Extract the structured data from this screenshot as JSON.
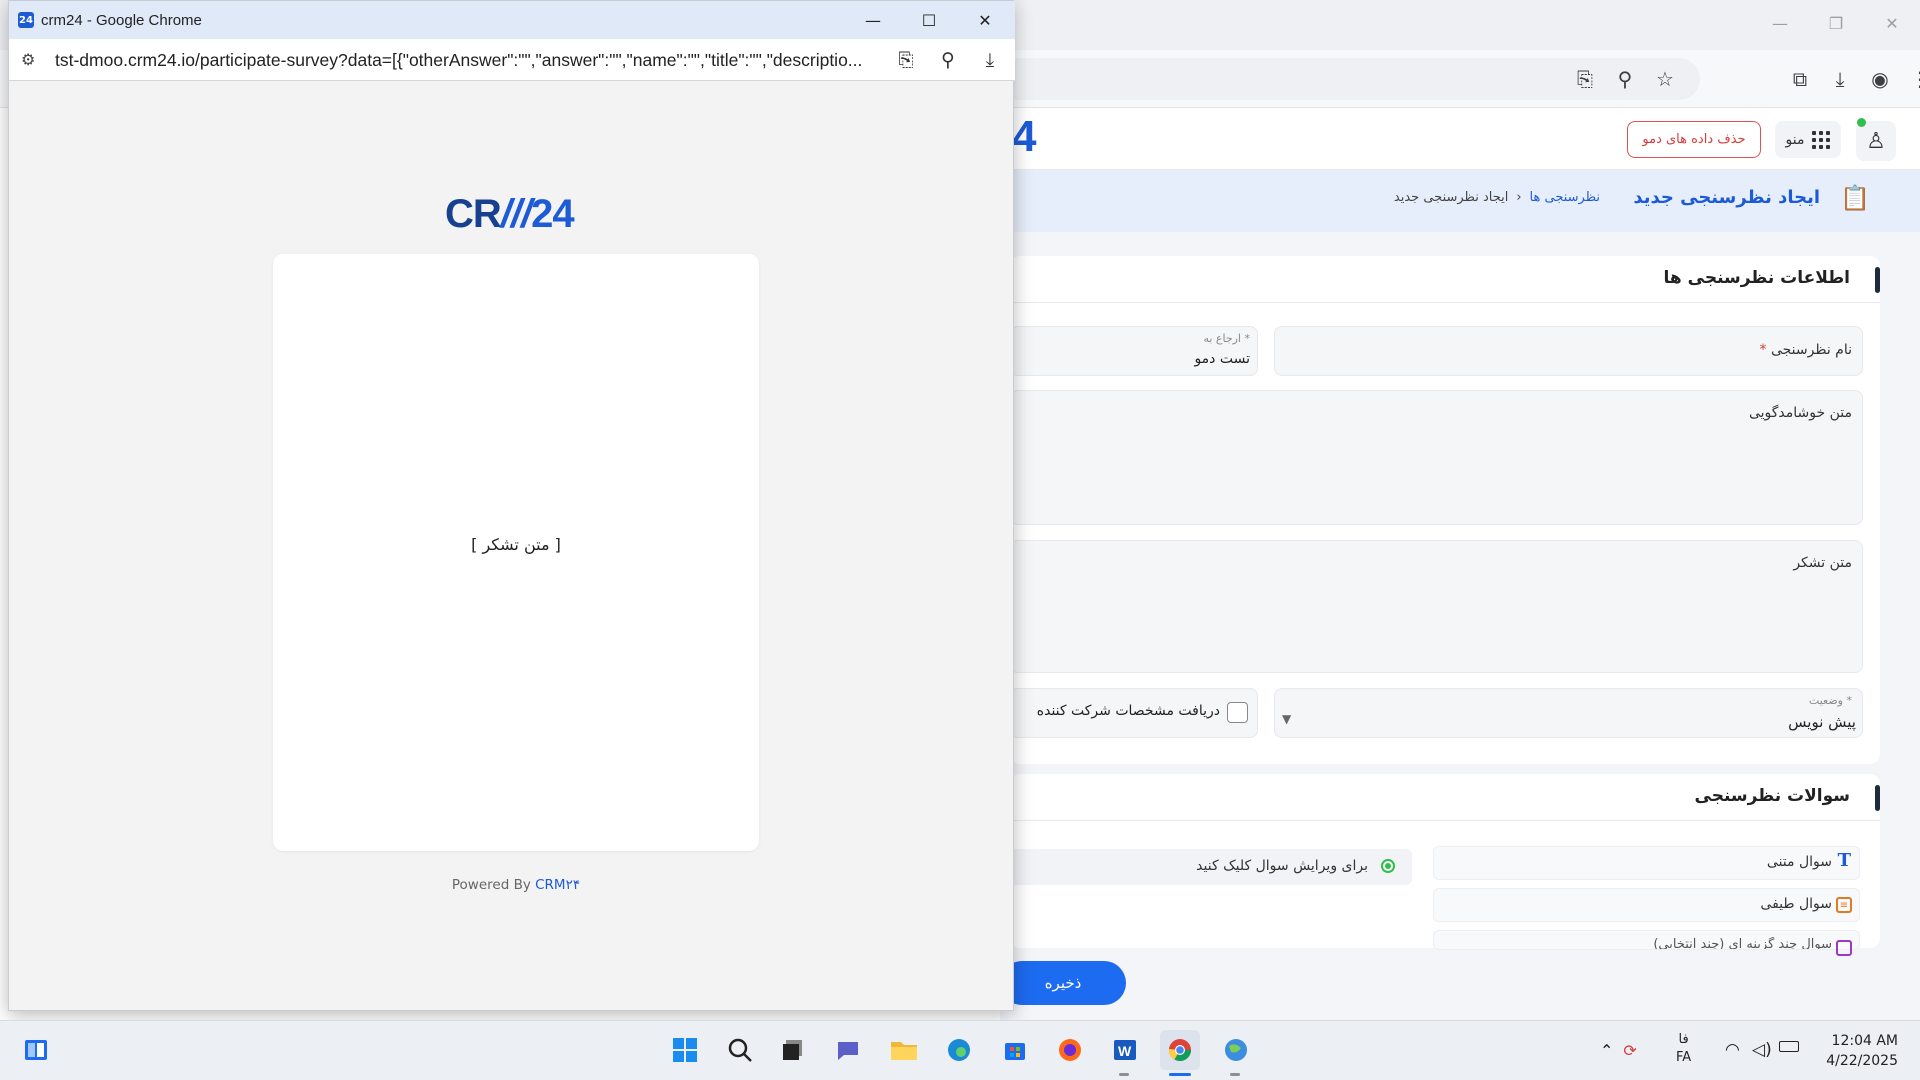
{
  "background_window": {
    "header": {
      "logo_fragment": "4",
      "demo_delete_button": "حذف داده های دمو",
      "menu_label": "منو"
    },
    "page": {
      "title": "ایجاد نظرسنجی جدید",
      "breadcrumb": [
        "نظرسنجی ها",
        "ایجاد نظرسنجی جدید"
      ],
      "breadcrumb_separator": "‹"
    },
    "section_info": {
      "title": "اطلاعات نظرسنجی ها",
      "name_label": "نام نظرسنجی",
      "required_mark": "*",
      "ref_label": "ارجاع به *",
      "ref_value": "تست دمو",
      "welcome_label": "متن خوشامدگویی",
      "thanks_label": "متن تشکر",
      "status_label": "وضعیت *",
      "status_value": "پیش نویس",
      "collect_label": "دریافت مشخصات شرکت کننده"
    },
    "section_questions": {
      "title": "سوالات نظرسنجی",
      "hint": "برای ویرایش سوال کلیک کنید",
      "types": [
        "سوال متنی",
        "سوال طیفی",
        "سوال چند گزینه ای (چند انتخابی)"
      ]
    },
    "save_button": "ذخیره"
  },
  "popup": {
    "title": "crm24 - Google Chrome",
    "url": "tst-dmoo.crm24.io/participate-survey?data=[{\"otherAnswer\":\"\",\"answer\":\"\",\"name\":\"\",\"title\":\"\",\"descriptio...",
    "logo": {
      "part1": "CR",
      "part2": "///",
      "part3": "24"
    },
    "thanks_text": "[ متن تشکر ]",
    "powered_prefix": "Powered By",
    "powered_brand": "CRM۲۴"
  },
  "taskbar": {
    "lang_top": "فا",
    "lang_bottom": "FA",
    "time": "12:04 AM",
    "date": "4/22/2025"
  },
  "colors": {
    "brand_blue": "#1d5bd6",
    "save_button": "#1d6bf0",
    "danger": "#d63b3b",
    "online": "#2fbf4a"
  }
}
